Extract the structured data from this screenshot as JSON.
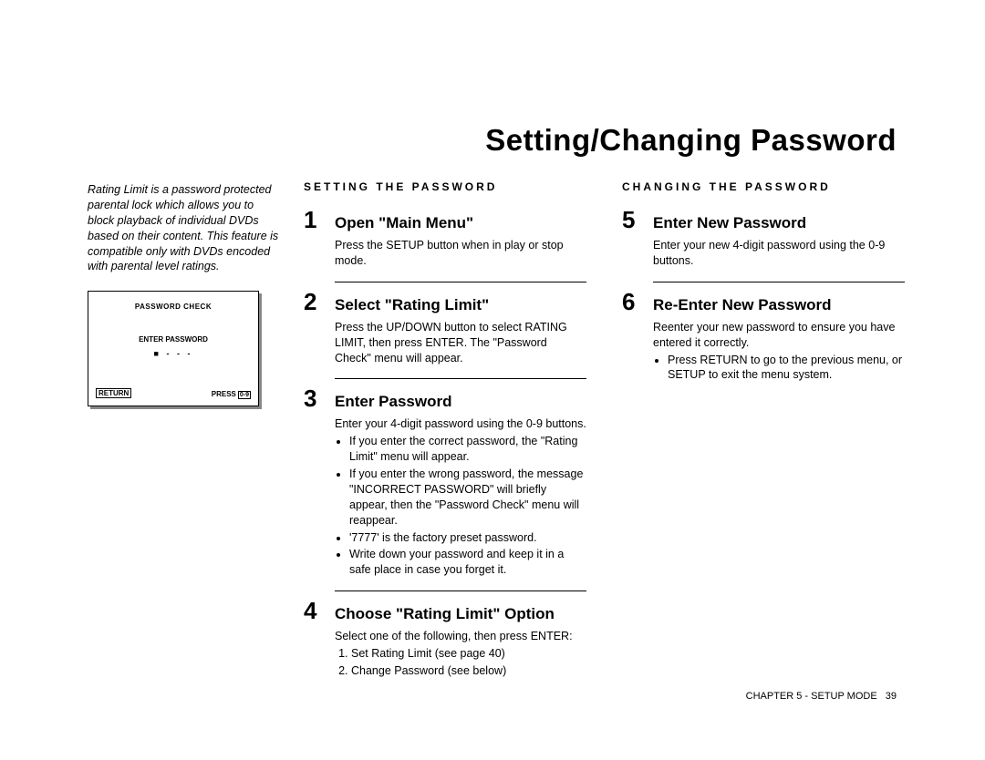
{
  "title": "Setting/Changing Password",
  "intro": "Rating Limit is a password protected parental lock which allows you to block playback of individual DVDs based on their content. This feature is compatible only with DVDs encoded with parental level ratings.",
  "screen": {
    "title": "PASSWORD CHECK",
    "enter": "ENTER PASSWORD",
    "cursor": "■ - - -",
    "return": "RETURN",
    "press": "PRESS",
    "btn": "0-9"
  },
  "left": {
    "heading": "SETTING THE PASSWORD",
    "steps": [
      {
        "num": "1",
        "title": "Open \"Main Menu\"",
        "body": "Press the SETUP button when in play or stop mode."
      },
      {
        "num": "2",
        "title": "Select \"Rating Limit\"",
        "body": "Press the UP/DOWN button to select RATING LIMIT, then press ENTER. The \"Password Check\" menu will appear."
      },
      {
        "num": "3",
        "title": "Enter Password",
        "body": "Enter your 4-digit password using the 0-9 buttons.",
        "bullets": [
          "If you enter the correct password, the \"Rating Limit\" menu will appear.",
          "If you enter the wrong password, the message \"INCORRECT PASSWORD\" will briefly appear, then the \"Password Check\" menu will reappear.",
          "'7777' is the factory preset password.",
          "Write down your password and keep it in a safe place in case you forget it."
        ]
      },
      {
        "num": "4",
        "title": "Choose \"Rating Limit\" Option",
        "body": "Select one of the following, then press ENTER:",
        "ordered": [
          "Set Rating Limit (see page 40)",
          "Change Password (see below)"
        ]
      }
    ]
  },
  "right": {
    "heading": "CHANGING THE PASSWORD",
    "steps": [
      {
        "num": "5",
        "title": "Enter New Password",
        "body": "Enter your new 4-digit password using the 0-9 buttons."
      },
      {
        "num": "6",
        "title": "Re-Enter New Password",
        "body": "Reenter your new password to ensure you have entered it correctly.",
        "bullets": [
          "Press RETURN to go to the previous menu, or SETUP to exit the menu system."
        ]
      }
    ]
  },
  "footer": {
    "chapter": "CHAPTER 5 - SETUP MODE",
    "page": "39"
  }
}
